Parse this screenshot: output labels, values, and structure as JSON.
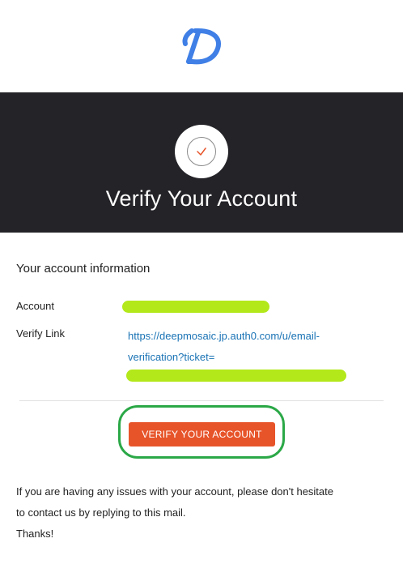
{
  "brand": {
    "logo_letter": "D",
    "logo_color": "#3f7fe6"
  },
  "banner": {
    "title": "Verify Your Account",
    "background": "#242328",
    "icon": "checkmark-icon"
  },
  "account_info": {
    "section_title": "Your account information",
    "account_label": "Account",
    "verify_link_label": "Verify Link",
    "verify_link_line1": "https://deepmosaic.jp.auth0.com/u/email-",
    "verify_link_line2": "verification?ticket=",
    "redaction_color": "#b3e81a"
  },
  "cta": {
    "button_label": "VERIFY YOUR ACCOUNT",
    "button_color": "#e7542a",
    "ring_color": "#2ba847"
  },
  "footer": {
    "line1": "If you are having any issues with your account, please don't hesitate",
    "line2": "to contact us by replying to this mail.",
    "line3": "Thanks!"
  }
}
